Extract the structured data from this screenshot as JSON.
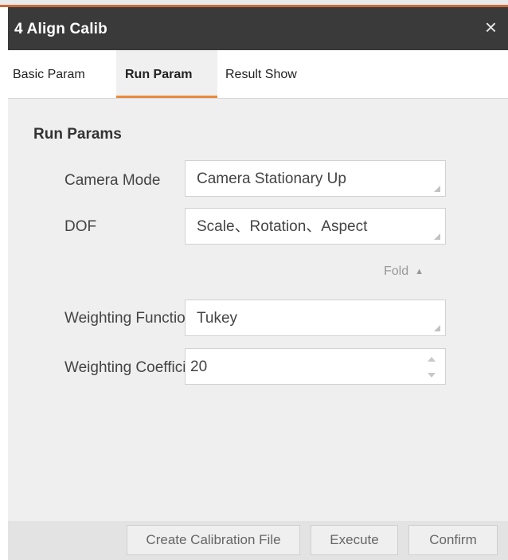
{
  "window": {
    "title": "4 Align Calib",
    "close_icon": "×"
  },
  "tabs": [
    {
      "label": "Basic Param"
    },
    {
      "label": "Run Param",
      "active": true
    },
    {
      "label": "Result Show"
    }
  ],
  "section_title": "Run Params",
  "fields": {
    "camera_mode": {
      "label": "Camera Mode",
      "value": "Camera Stationary Up"
    },
    "dof": {
      "label": "DOF",
      "value": "Scale、Rotation、Aspect"
    },
    "weighting_function": {
      "label": "Weighting Function",
      "value": "Tukey"
    },
    "weighting_coefficient": {
      "label": "Weighting Coefficient",
      "value": "20"
    }
  },
  "fold": {
    "label": "Fold",
    "icon": "chevron-up-icon"
  },
  "buttons": {
    "create_calibration_file": "Create Calibration File",
    "execute": "Execute",
    "confirm": "Confirm"
  },
  "colors": {
    "titlebar": "#3a3a3a",
    "accent": "#e88a3c",
    "panel": "#efefef"
  }
}
